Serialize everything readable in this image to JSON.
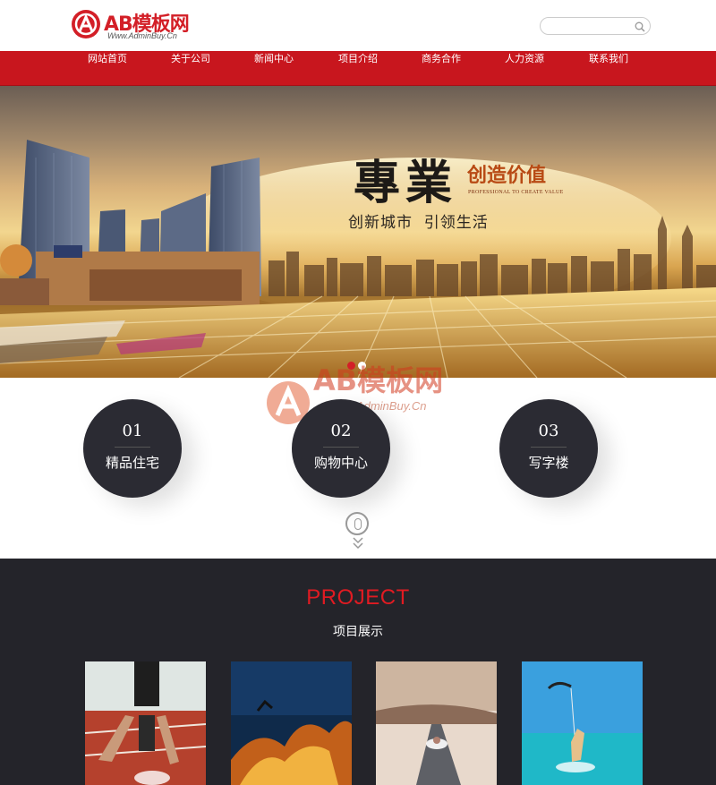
{
  "header": {
    "logo_text": "AB模板网",
    "logo_url": "Www.AdminBuy.Cn",
    "search_placeholder": ""
  },
  "nav": {
    "items": [
      "网站首页",
      "关于公司",
      "新闻中心",
      "项目介绍",
      "商务合作",
      "人力资源",
      "联系我们"
    ]
  },
  "banner": {
    "title": "專業",
    "tagline": "创造价值",
    "tagline_en": "PROFESSIONAL TO CREATE VALUE",
    "subtitle": "创新城市  引领生活",
    "dots": [
      {
        "active": true,
        "color": "#d31f27"
      },
      {
        "active": false,
        "color": "#ffffff"
      }
    ]
  },
  "watermark": {
    "text": "AB模板网",
    "url": "Www.AdminBuy.Cn"
  },
  "features": [
    {
      "num": "01",
      "label": "精品住宅"
    },
    {
      "num": "02",
      "label": "购物中心"
    },
    {
      "num": "03",
      "label": "写字楼"
    }
  ],
  "projects": {
    "title": "PROJECT",
    "subtitle": "项目展示",
    "items": [
      {
        "icon": "runner-photo"
      },
      {
        "icon": "fire-sky-photo"
      },
      {
        "icon": "swimmer-road-photo"
      },
      {
        "icon": "kitesurfer-photo"
      }
    ]
  },
  "colors": {
    "brand_red": "#c8161e",
    "dark_bg": "#24242a",
    "circle_bg": "#2b2b33"
  }
}
